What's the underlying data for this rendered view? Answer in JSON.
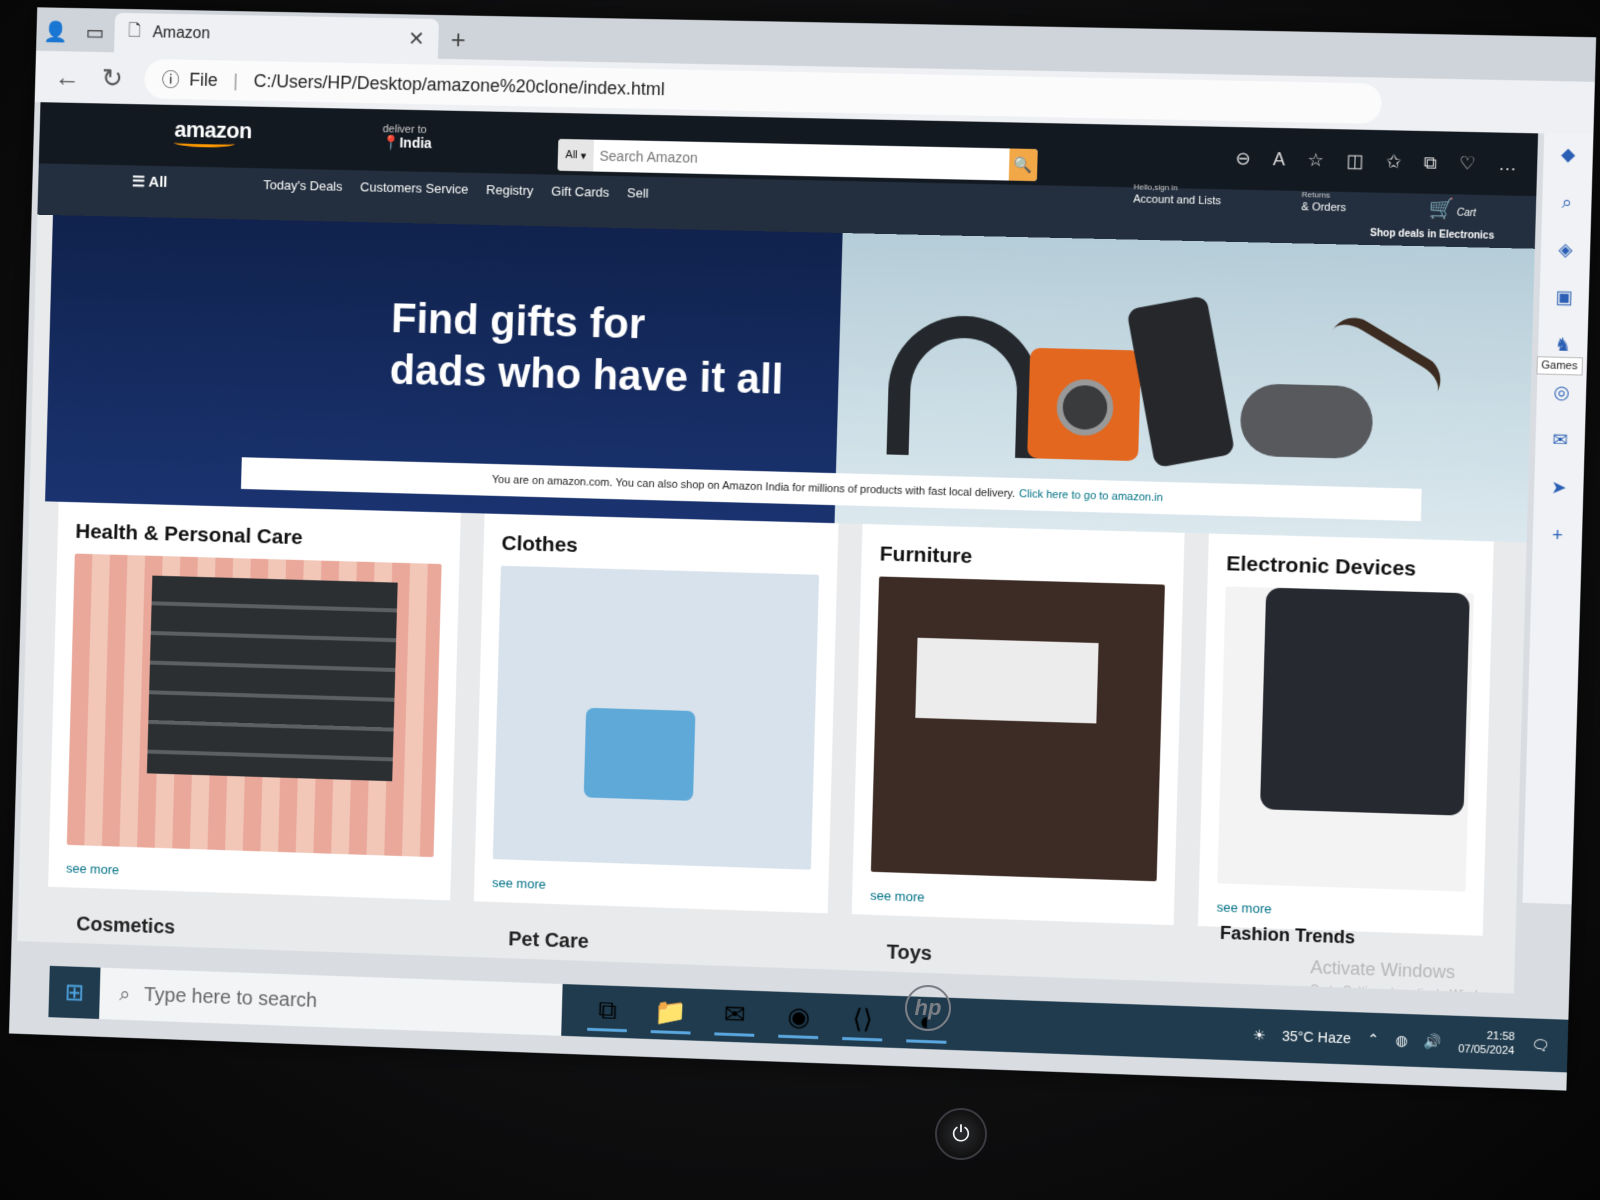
{
  "browser": {
    "tab_title": "Amazon",
    "url_scheme": "File",
    "url_path": "C:/Users/HP/Desktop/amazone%20clone/index.html"
  },
  "amazon": {
    "logo": "amazon",
    "deliver_label": "deliver to",
    "deliver_location": "India",
    "search_category": "All",
    "search_placeholder": "Search Amazon",
    "account_small": "Hello,sign in",
    "account_label": "Account and Lists",
    "orders_small": "Returns",
    "orders_label": "& Orders",
    "cart_label": "Cart",
    "nav_all": "All",
    "nav_items": [
      "Today's Deals",
      "Customers Service",
      "Registry",
      "Gift Cards",
      "Sell"
    ],
    "deals_strip": "Shop deals in Electronics",
    "hero_title_line1": "Find gifts for",
    "hero_title_line2": "dads who have it all",
    "notice_text": "You are on amazon.com. You can also shop on Amazon India for millions of products with fast local delivery.",
    "notice_link": "Click here to go to amazon.in",
    "cards": [
      {
        "title": "Health & Personal Care",
        "see_more": "see more"
      },
      {
        "title": "Clothes",
        "see_more": "see more"
      },
      {
        "title": "Furniture",
        "see_more": "see more"
      },
      {
        "title": "Electronic Devices",
        "see_more": "see more"
      }
    ],
    "second_row": [
      "Cosmetics",
      "Pet Care",
      "Toys",
      "Fashion Trends"
    ]
  },
  "edge_sidebar": {
    "tooltip": "Games"
  },
  "windows": {
    "activate_title": "Activate Windows",
    "activate_sub": "Go to Settings to activate Windows.",
    "search_placeholder": "Type here to search",
    "weather": "35°C Haze",
    "time": "21:58",
    "date": "07/05/2024"
  },
  "hardware": {
    "brand": "hp"
  }
}
